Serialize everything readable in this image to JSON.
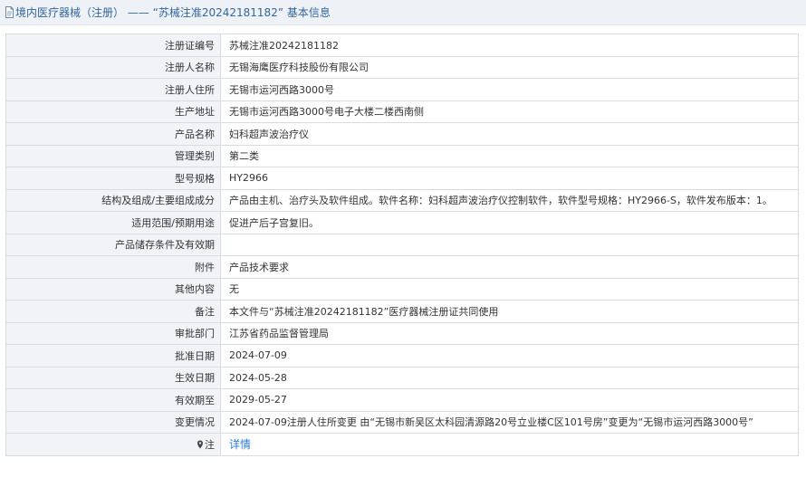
{
  "header": {
    "title": "境内医疗器械（注册） —— “苏械注准20242181182” 基本信息"
  },
  "rows": [
    {
      "label": "注册证编号",
      "value": "苏械注准20242181182"
    },
    {
      "label": "注册人名称",
      "value": "无锡海鹰医疗科技股份有限公司"
    },
    {
      "label": "注册人住所",
      "value": "无锡市运河西路3000号"
    },
    {
      "label": "生产地址",
      "value": "无锡市运河西路3000号电子大楼二楼西南侧"
    },
    {
      "label": "产品名称",
      "value": "妇科超声波治疗仪"
    },
    {
      "label": "管理类别",
      "value": "第二类"
    },
    {
      "label": "型号规格",
      "value": "HY2966"
    },
    {
      "label": "结构及组成/主要组成成分",
      "value": "产品由主机、治疗头及软件组成。软件名称：妇科超声波治疗仪控制软件，软件型号规格：HY2966-S，软件发布版本：1。"
    },
    {
      "label": "适用范围/预期用途",
      "value": "促进产后子宫复旧。"
    },
    {
      "label": "产品储存条件及有效期",
      "value": ""
    },
    {
      "label": "附件",
      "value": "产品技术要求"
    },
    {
      "label": "其他内容",
      "value": "无"
    },
    {
      "label": "备注",
      "value": "本文件与“苏械注准20242181182”医疗器械注册证共同使用"
    },
    {
      "label": "审批部门",
      "value": "江苏省药品监督管理局"
    },
    {
      "label": "批准日期",
      "value": "2024-07-09"
    },
    {
      "label": "生效日期",
      "value": "2024-05-28"
    },
    {
      "label": "有效期至",
      "value": "2029-05-27"
    },
    {
      "label": "变更情况",
      "value": "2024-07-09注册人住所变更 由“无锡市新吴区太科园清源路20号立业楼C区101号房”变更为“无锡市运河西路3000号”"
    }
  ],
  "note_row": {
    "label": "注",
    "link_text": "详情"
  },
  "colors": {
    "title_text": "#336699",
    "label_bg": "#f1f3f7",
    "border": "#d6dbe4",
    "link": "#2a7bd5"
  }
}
